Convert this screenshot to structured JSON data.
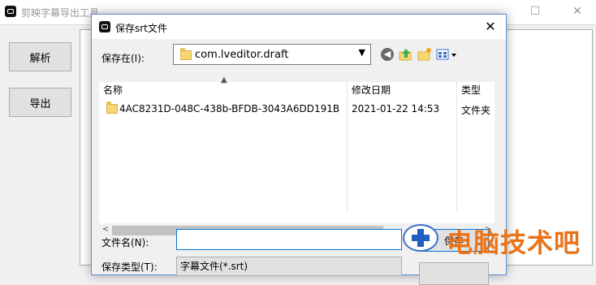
{
  "main_window": {
    "title": "剪映字幕导出工具",
    "buttons": {
      "parse": "解析",
      "export": "导出"
    }
  },
  "dialog": {
    "title": "保存srt文件",
    "close": "✕",
    "save_in_label": "保存在(I):",
    "save_in_value": "com.lveditor.draft",
    "columns": {
      "name": "名称",
      "modified": "修改日期",
      "type": "类型"
    },
    "rows": [
      {
        "name": "4AC8231D-048C-438b-BFDB-3043A6DD191B",
        "modified": "2021-01-22 14:53",
        "type": "文件夹"
      }
    ],
    "filename_label": "文件名(N):",
    "filename_value": "",
    "save_button": "保存",
    "filetype_label": "保存类型(T):",
    "filetype_value": "字幕文件(*.srt)"
  },
  "watermark": {
    "text": "电脑技术吧"
  },
  "colors": {
    "accent": "#0078d7",
    "watermark_text": "#e8731a",
    "watermark_icon": "#1f5fbf"
  }
}
